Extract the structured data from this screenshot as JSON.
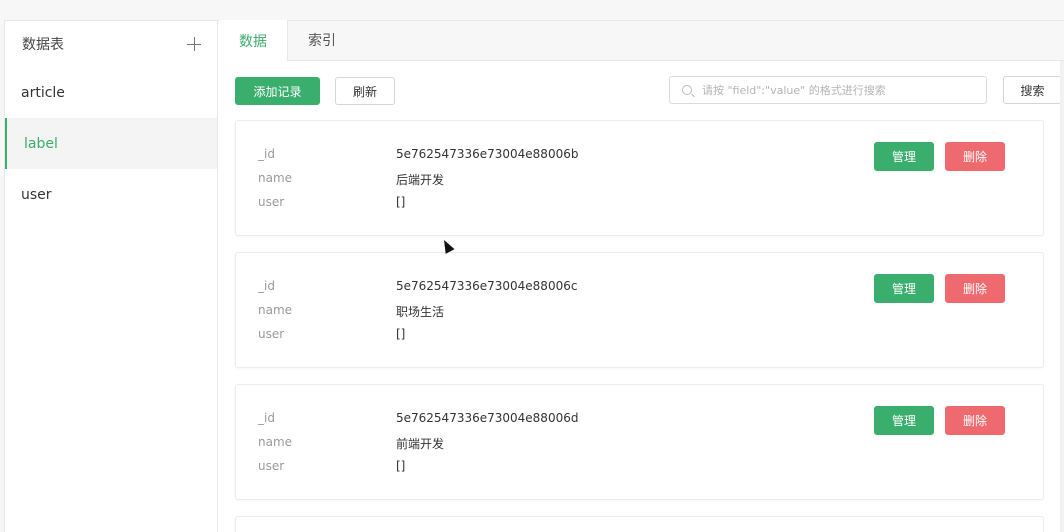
{
  "sidebar": {
    "title": "数据表",
    "add_icon": "plus-icon",
    "items": [
      {
        "label": "article"
      },
      {
        "label": "label"
      },
      {
        "label": "user"
      }
    ],
    "active_index": 1
  },
  "tabs": [
    {
      "label": "数据"
    },
    {
      "label": "索引"
    }
  ],
  "toolbar": {
    "add_label": "添加记录",
    "refresh_label": "刷新",
    "search_placeholder": "请按 \"field\":\"value\" 的格式进行搜索",
    "search_label": "搜索"
  },
  "records": [
    {
      "id_key": "_id",
      "id": "5e762547336e73004e88006b",
      "name_key": "name",
      "name": "后端开发",
      "user_key": "user",
      "user": "[]",
      "manage": "管理",
      "delete": "删除"
    },
    {
      "id_key": "_id",
      "id": "5e762547336e73004e88006c",
      "name_key": "name",
      "name": "职场生活",
      "user_key": "user",
      "user": "[]",
      "manage": "管理",
      "delete": "删除"
    },
    {
      "id_key": "_id",
      "id": "5e762547336e73004e88006d",
      "name_key": "name",
      "name": "前端开发",
      "user_key": "user",
      "user": "[]",
      "manage": "管理",
      "delete": "删除"
    }
  ],
  "colors": {
    "accent": "#3aae6d",
    "danger": "#ee6a6e"
  }
}
